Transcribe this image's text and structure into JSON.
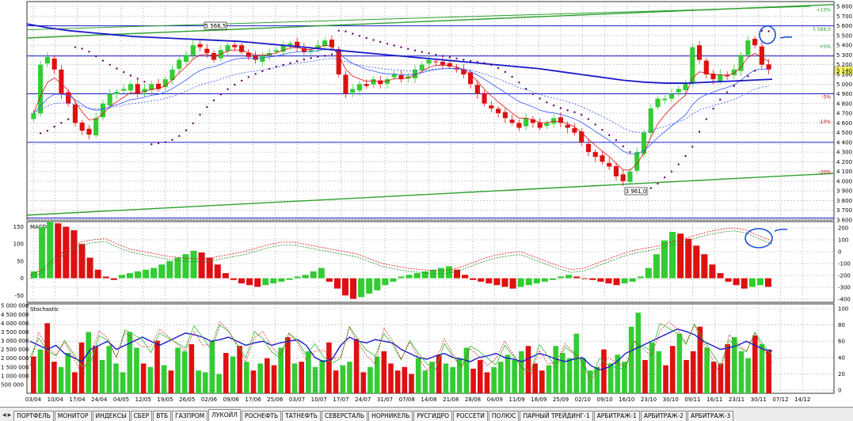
{
  "chart_data": [
    {
      "type": "candlestick",
      "panel": "price",
      "price_callouts": [
        "5 566,5",
        "3 961,0"
      ],
      "current_price": "5 140,0",
      "yticks": [
        "5 800",
        "5 700",
        "5 600",
        "5 500",
        "5 400",
        "5 300",
        "5 200",
        "5 100",
        "5 000",
        "4 900",
        "4 800",
        "4 700",
        "4 600",
        "4 500",
        "4 400",
        "4 300",
        "4 200",
        "4 100",
        "4 000",
        "3 900",
        "3 800",
        "3 700",
        "3 600"
      ],
      "level_labels": [
        {
          "text": "+10%",
          "value": 5766,
          "color": "#2ca02c"
        },
        {
          "text": "5 566,0",
          "value": 5566,
          "color": "#2ca02c"
        },
        {
          "text": "+5%",
          "value": 5385,
          "color": "#2ca02c"
        },
        {
          "text": "-5%",
          "value": 4868,
          "color": "#cc0000"
        },
        {
          "text": "-10%",
          "value": 4610,
          "color": "#cc0000"
        },
        {
          "text": "-20%",
          "value": 4095,
          "color": "#cc0000"
        }
      ],
      "ylim": [
        3600,
        5850
      ],
      "close_series": [
        4700,
        5200,
        5280,
        5150,
        4900,
        4800,
        4600,
        4520,
        4480,
        4650,
        4800,
        4900,
        4920,
        4950,
        5000,
        4900,
        4950,
        5000,
        4950,
        5050,
        5150,
        5250,
        5300,
        5400,
        5380,
        5320,
        5250,
        5350,
        5400,
        5380,
        5330,
        5280,
        5250,
        5300,
        5320,
        5350,
        5400,
        5420,
        5380,
        5330,
        5350,
        5400,
        5450,
        5380,
        5100,
        4900,
        4950,
        5000,
        4980,
        5050,
        5000,
        5050,
        5100,
        5050,
        5080,
        5150,
        5200,
        5250,
        5230,
        5200,
        5180,
        5150,
        5100,
        5000,
        4900,
        4800,
        4750,
        4700,
        4650,
        4600,
        4550,
        4650,
        4600,
        4550,
        4600,
        4650,
        4600,
        4550,
        4500,
        4400,
        4300,
        4250,
        4200,
        4150,
        4050,
        4000,
        4100,
        4300,
        4500,
        4750,
        4850,
        4850,
        4900,
        4950,
        5000,
        5380,
        5250,
        5100,
        5050,
        5100,
        5080,
        5150,
        5300,
        5450,
        5400,
        5200,
        5150
      ],
      "horizontal_levels": [
        5600,
        5290,
        4900,
        4400,
        3620
      ],
      "upper_channel": [
        5475,
        5820
      ],
      "lower_channel": [
        3650,
        4080
      ],
      "ma_long": [
        5620,
        5580,
        5550,
        5530,
        5510,
        5490,
        5480,
        5470,
        5460,
        5450,
        5440,
        5420,
        5400,
        5380,
        5360,
        5340,
        5320,
        5300,
        5280,
        5260,
        5240,
        5220,
        5200,
        5180,
        5160,
        5130,
        5100,
        5070,
        5040,
        5020,
        5010,
        5010,
        5020,
        5030,
        5040,
        5050
      ]
    },
    {
      "type": "bar",
      "panel": "macd",
      "label": "MACD",
      "yticks_left": [
        "150",
        "100",
        "50",
        "0",
        "-50"
      ],
      "yticks_right": [
        "200",
        "100",
        "0",
        "-100",
        "-200",
        "-300",
        "-400"
      ],
      "ylim": [
        -70,
        165
      ],
      "histogram": [
        20,
        150,
        165,
        160,
        150,
        140,
        100,
        60,
        25,
        5,
        -5,
        10,
        15,
        20,
        25,
        30,
        40,
        50,
        60,
        70,
        80,
        75,
        60,
        40,
        15,
        -5,
        -15,
        -20,
        -25,
        -20,
        -15,
        -10,
        -5,
        5,
        10,
        20,
        30,
        -10,
        -30,
        -50,
        -60,
        -55,
        -45,
        -35,
        -20,
        -10,
        5,
        10,
        15,
        20,
        25,
        30,
        35,
        25,
        10,
        -5,
        -10,
        -15,
        -20,
        -25,
        -30,
        -25,
        -20,
        -15,
        -10,
        -5,
        5,
        10,
        5,
        0,
        -5,
        -10,
        -15,
        -20,
        -15,
        -10,
        5,
        30,
        70,
        110,
        135,
        130,
        115,
        95,
        70,
        40,
        15,
        -10,
        -20,
        -30,
        -25,
        -20,
        -25
      ],
      "signal_right": [
        -200,
        -150,
        -50,
        20,
        80,
        100,
        110,
        60,
        20,
        0,
        -20,
        -40,
        -50,
        -60,
        -60,
        -40,
        -20,
        0,
        30,
        60,
        80,
        80,
        60,
        40,
        20,
        0,
        -20,
        -60,
        -100,
        -120,
        -140,
        -150,
        -160,
        -160,
        -140,
        -100,
        -60,
        -30,
        -10,
        0,
        -40,
        -80,
        -120,
        -150,
        -140,
        -100,
        -60,
        -20,
        10,
        30,
        50,
        80,
        110,
        140,
        170,
        190,
        200,
        180,
        130,
        90
      ]
    },
    {
      "type": "bar",
      "panel": "volume-stochastic",
      "label": "Stochastic",
      "yticks_left": [
        "5 000 000",
        "4 500 000",
        "4 000 000",
        "3 500 000",
        "3 000 000",
        "2 500 000",
        "2 000 000",
        "1 500 000",
        "1 000 000",
        "500 000"
      ],
      "yticks_right": [
        "100",
        "80",
        "60",
        "40",
        "20",
        "0"
      ],
      "volume_ylim": [
        0,
        5100000
      ],
      "volumes": [
        2100000,
        2500000,
        4000000,
        1800000,
        1500000,
        2300000,
        1200000,
        2900000,
        3500000,
        2700000,
        1900000,
        2700000,
        1700000,
        1200000,
        3500000,
        2600000,
        1700000,
        1500000,
        3000000,
        1600000,
        1300000,
        2600000,
        2400000,
        2800000,
        1300000,
        1200000,
        3000000,
        1100000,
        2300000,
        2100000,
        2700000,
        1800000,
        1300000,
        1700000,
        2000000,
        1600000,
        2600000,
        3200000,
        1700000,
        1800000,
        2400000,
        1500000,
        1900000,
        2900000,
        1300000,
        1600000,
        1800000,
        3100000,
        1200000,
        1500000,
        2100000,
        2400000,
        1700000,
        1300000,
        1500000,
        1100000,
        2000000,
        1300000,
        1800000,
        2200000,
        1700000,
        1500000,
        2000000,
        2600000,
        1400000,
        1900000,
        1200000,
        1500000,
        1800000,
        2200000,
        1900000,
        2400000,
        2700000,
        1700000,
        1300000,
        1600000,
        2700000,
        2300000,
        2000000,
        3400000,
        2000000,
        1300000,
        1500000,
        2500000,
        1700000,
        2200000,
        1800000,
        3800000,
        4600000,
        1900000,
        2900000,
        2400000,
        1600000,
        2700000,
        3400000,
        1900000,
        2400000,
        3800000,
        2600000,
        1800000,
        1700000,
        2800000,
        3200000,
        2400000,
        2000000,
        3300000,
        2800000,
        2500000
      ],
      "stoch_k": [
        60,
        55,
        50,
        55,
        45,
        40,
        35,
        50,
        55,
        60,
        50,
        55,
        60,
        65,
        60,
        55,
        60,
        65,
        70,
        68,
        65,
        60,
        62,
        65,
        60,
        55,
        58,
        60,
        55,
        58,
        60,
        62,
        55,
        40,
        35,
        38,
        55,
        65,
        60,
        58,
        62,
        60,
        58,
        50,
        45,
        40,
        38,
        42,
        45,
        40,
        38,
        35,
        40,
        42,
        45,
        40,
        38,
        35,
        40,
        45,
        42,
        38,
        35,
        38,
        40,
        30,
        25,
        28,
        35,
        45,
        50,
        55,
        60,
        65,
        70,
        75,
        72,
        68,
        60,
        55,
        50,
        52,
        55,
        60,
        55,
        50,
        48
      ]
    }
  ],
  "x_dates": [
    "03/04",
    "10/04",
    "17/04",
    "24/04",
    "04/05",
    "12/05",
    "19/05",
    "26/05",
    "02/06",
    "09/06",
    "17/06",
    "25/06",
    "03/07",
    "10/07",
    "17/07",
    "24/07",
    "31/07",
    "07/08",
    "14/08",
    "21/08",
    "28/08",
    "04/09",
    "11/09",
    "18/09",
    "25/09",
    "02/10",
    "09/10",
    "16/10",
    "23/10",
    "30/10",
    "09/11",
    "16/11",
    "23/11",
    "30/11",
    "07/12",
    "14/12"
  ],
  "tabs": [
    "ПОРТФЕЛЬ",
    "МОНИТОР",
    "ИНДЕКСЫ",
    "СБЕР",
    "ВТБ",
    "ГАЗПРОМ",
    "ЛУКОЙЛ",
    "РОСНЕФТЬ",
    "ТАТНЕФТЬ",
    "СЕВЕРСТАЛЬ",
    "НОРНИКЕЛЬ",
    "РУСГИДРО",
    "РОССЕТИ",
    "ПОЛЮС",
    "ПАРНЫЙ ТРЕЙДИНГ-1",
    "АРБИТРАЖ-1",
    "АРБИТРАЖ-2",
    "АРБИТРАЖ-3"
  ],
  "active_tab": "ЛУКОЙЛ",
  "colors": {
    "up": "#33cc33",
    "down": "#dd1111",
    "ma_long": "#1a1acc",
    "channel": "#2ca02c",
    "level": "#1a1acc",
    "sar": "#660066",
    "annot": "#1a4fd6"
  }
}
